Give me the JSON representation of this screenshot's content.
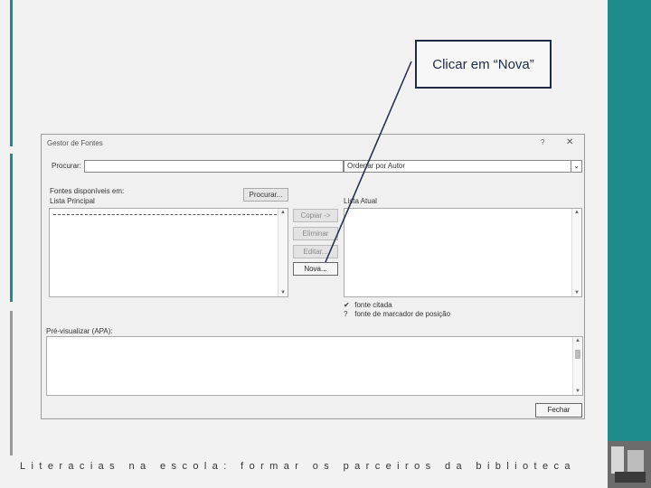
{
  "callout": {
    "text": "Clicar em “Nova”"
  },
  "dialog": {
    "title": "Gestor de Fontes",
    "help_label": "?",
    "close_label": "✕",
    "search_label": "Procurar:",
    "search_value": "",
    "sort_value": "Ordenar por Autor",
    "sources_label": "Fontes disponíveis em:",
    "master_list_label": "Lista Principal",
    "browse_button": "Procurar...",
    "buttons": {
      "copy": "Copiar ->",
      "delete": "Eliminar",
      "edit": "Editar...",
      "new": "Nova..."
    },
    "current_list_label": "Lista Atual",
    "legend_cited": "fonte citada",
    "legend_placeholder": "fonte de marcador de posição",
    "legend_cited_mark": "✔",
    "legend_placeholder_mark": "?",
    "preview_label": "Pré-visualizar (APA):",
    "close_button": "Fechar"
  },
  "footer": {
    "text": "Literacias na escola: formar os parceiros da biblioteca"
  },
  "colors": {
    "accent": "#1e8c8c",
    "callout_border": "#1f2a44"
  }
}
